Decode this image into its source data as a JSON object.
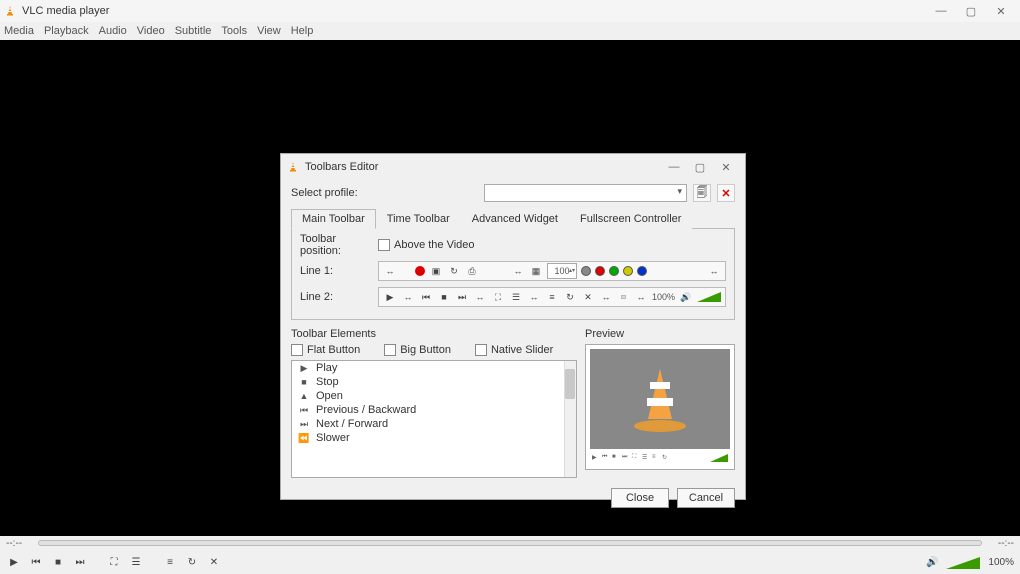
{
  "window": {
    "title": "VLC media player",
    "menu": [
      "Media",
      "Playback",
      "Audio",
      "Video",
      "Subtitle",
      "Tools",
      "View",
      "Help"
    ]
  },
  "seek": {
    "left": "--:--",
    "right": "--:--"
  },
  "main_controls": {
    "volume_pct": "100%"
  },
  "dialog": {
    "title": "Toolbars Editor",
    "select_profile_label": "Select profile:",
    "tabs": [
      "Main Toolbar",
      "Time Toolbar",
      "Advanced Widget",
      "Fullscreen Controller"
    ],
    "toolbar_position_label": "Toolbar position:",
    "above_video_label": "Above the Video",
    "line1_label": "Line 1:",
    "line2_label": "Line 2:",
    "spin_value": "100",
    "line2_volume": "100%",
    "elements_title": "Toolbar Elements",
    "preview_title": "Preview",
    "flat_button_label": "Flat Button",
    "big_button_label": "Big Button",
    "native_slider_label": "Native Slider",
    "list": [
      {
        "icon": "▶",
        "label": "Play"
      },
      {
        "icon": "■",
        "label": "Stop"
      },
      {
        "icon": "▲",
        "label": "Open"
      },
      {
        "icon": "⏮",
        "label": "Previous / Backward"
      },
      {
        "icon": "⏭",
        "label": "Next / Forward"
      },
      {
        "icon": "⏪",
        "label": "Slower"
      }
    ],
    "close_label": "Close",
    "cancel_label": "Cancel"
  }
}
